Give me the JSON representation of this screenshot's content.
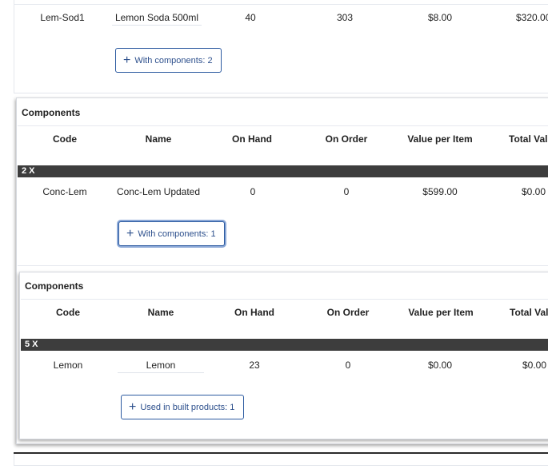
{
  "top_row": {
    "code": "Lem-Sod1",
    "name": "Lemon Soda 500ml",
    "on_hand": "40",
    "on_order": "303",
    "value_per_item": "$8.00",
    "total_value": "$320.00",
    "components_button": "With components: 2"
  },
  "level1": {
    "title": "Components",
    "headers": [
      "Code",
      "Name",
      "On Hand",
      "On Order",
      "Value per Item",
      "Total Val"
    ],
    "multiplier": "2 X",
    "row": {
      "code": "Conc-Lem",
      "name": "Conc-Lem Updated",
      "on_hand": "0",
      "on_order": "0",
      "value_per_item": "$599.00",
      "total_value": "$0.00"
    },
    "components_button": "With components: 1"
  },
  "level2": {
    "title": "Components",
    "headers": [
      "Code",
      "Name",
      "On Hand",
      "On Order",
      "Value per Item",
      "Total Val"
    ],
    "multiplier": "5 X",
    "row": {
      "code": "Lemon",
      "name": "Lemon",
      "on_hand": "23",
      "on_order": "0",
      "value_per_item": "$0.00",
      "total_value": "$0.00"
    },
    "used_in_button": "Used in built products: 1"
  }
}
